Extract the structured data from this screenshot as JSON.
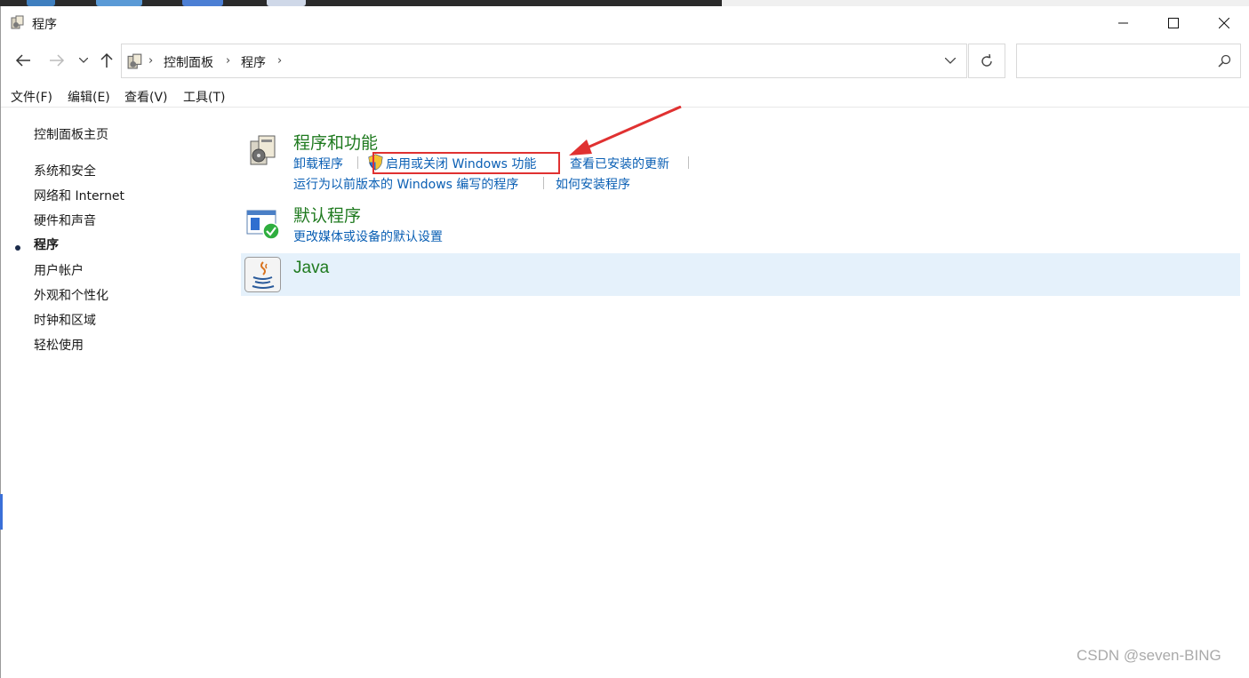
{
  "window": {
    "title": "程序"
  },
  "address": {
    "breadcrumbs": [
      "控制面板",
      "程序"
    ],
    "search_placeholder": ""
  },
  "menu": {
    "items": [
      "文件(F)",
      "编辑(E)",
      "查看(V)",
      "工具(T)"
    ]
  },
  "sidebar": {
    "home": "控制面板主页",
    "items": [
      "系统和安全",
      "网络和 Internet",
      "硬件和声音",
      "程序",
      "用户帐户",
      "外观和个性化",
      "时钟和区域",
      "轻松使用"
    ],
    "active_index": 3
  },
  "categories": {
    "programs": {
      "title": "程序和功能",
      "links": [
        "卸载程序",
        "启用或关闭 Windows 功能",
        "查看已安装的更新",
        "运行为以前版本的 Windows 编写的程序",
        "如何安装程序"
      ]
    },
    "defaults": {
      "title": "默认程序",
      "links": [
        "更改媒体或设备的默认设置"
      ]
    },
    "java": {
      "title": "Java"
    }
  },
  "watermark": "CSDN @seven-BING",
  "colors": {
    "link": "#0a5fb4",
    "category_title": "#1f7a1f",
    "highlight": "#e03131",
    "java_row_bg": "#e5f1fb"
  },
  "icons": {
    "title": "programs-icon",
    "back": "arrow-left-icon",
    "forward": "arrow-right-icon",
    "recent": "chevron-down-icon",
    "up": "arrow-up-icon",
    "refresh": "refresh-icon",
    "search": "search-icon",
    "minimize": "minimize-icon",
    "maximize": "maximize-icon",
    "close": "close-icon",
    "shield": "uac-shield-icon",
    "java": "java-icon",
    "default_programs": "default-programs-icon"
  }
}
